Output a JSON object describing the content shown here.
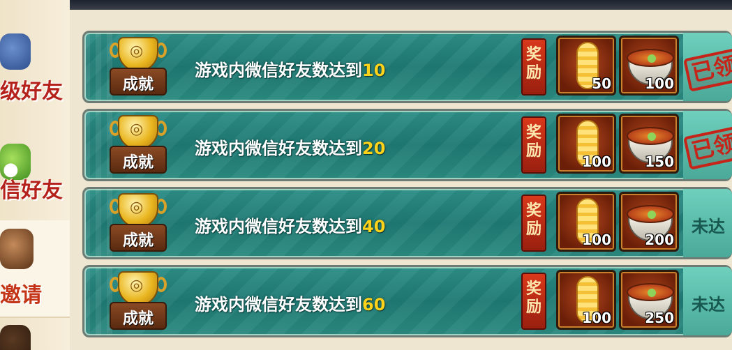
{
  "sidebar": {
    "tabs": [
      {
        "label": "级好友",
        "icon": "friend-avatar-icon"
      },
      {
        "label": "信好友",
        "icon": "wechat-icon"
      },
      {
        "label": "邀请",
        "icon": "ninja-avatar-icon"
      },
      {
        "label": "",
        "icon": "ninja-avatar-icon"
      }
    ]
  },
  "achievements": [
    {
      "text": "游戏内微信好友数达到",
      "target": "10",
      "badge": "成就",
      "reward_label": "奖励",
      "rewards": [
        {
          "icon": "scroll-icon",
          "count": "50"
        },
        {
          "icon": "ramen-icon",
          "count": "100"
        }
      ],
      "status": "已领",
      "status_type": "stamp"
    },
    {
      "text": "游戏内微信好友数达到",
      "target": "20",
      "badge": "成就",
      "reward_label": "奖励",
      "rewards": [
        {
          "icon": "scroll-icon",
          "count": "100"
        },
        {
          "icon": "ramen-icon",
          "count": "150"
        }
      ],
      "status": "已领",
      "status_type": "stamp"
    },
    {
      "text": "游戏内微信好友数达到",
      "target": "40",
      "badge": "成就",
      "reward_label": "奖励",
      "rewards": [
        {
          "icon": "scroll-icon",
          "count": "100"
        },
        {
          "icon": "ramen-icon",
          "count": "200"
        }
      ],
      "status": "未达",
      "status_type": "text"
    },
    {
      "text": "游戏内微信好友数达到",
      "target": "60",
      "badge": "成就",
      "reward_label": "奖励",
      "rewards": [
        {
          "icon": "scroll-icon",
          "count": "100"
        },
        {
          "icon": "ramen-icon",
          "count": "250"
        }
      ],
      "status": "未达",
      "status_type": "text"
    }
  ]
}
